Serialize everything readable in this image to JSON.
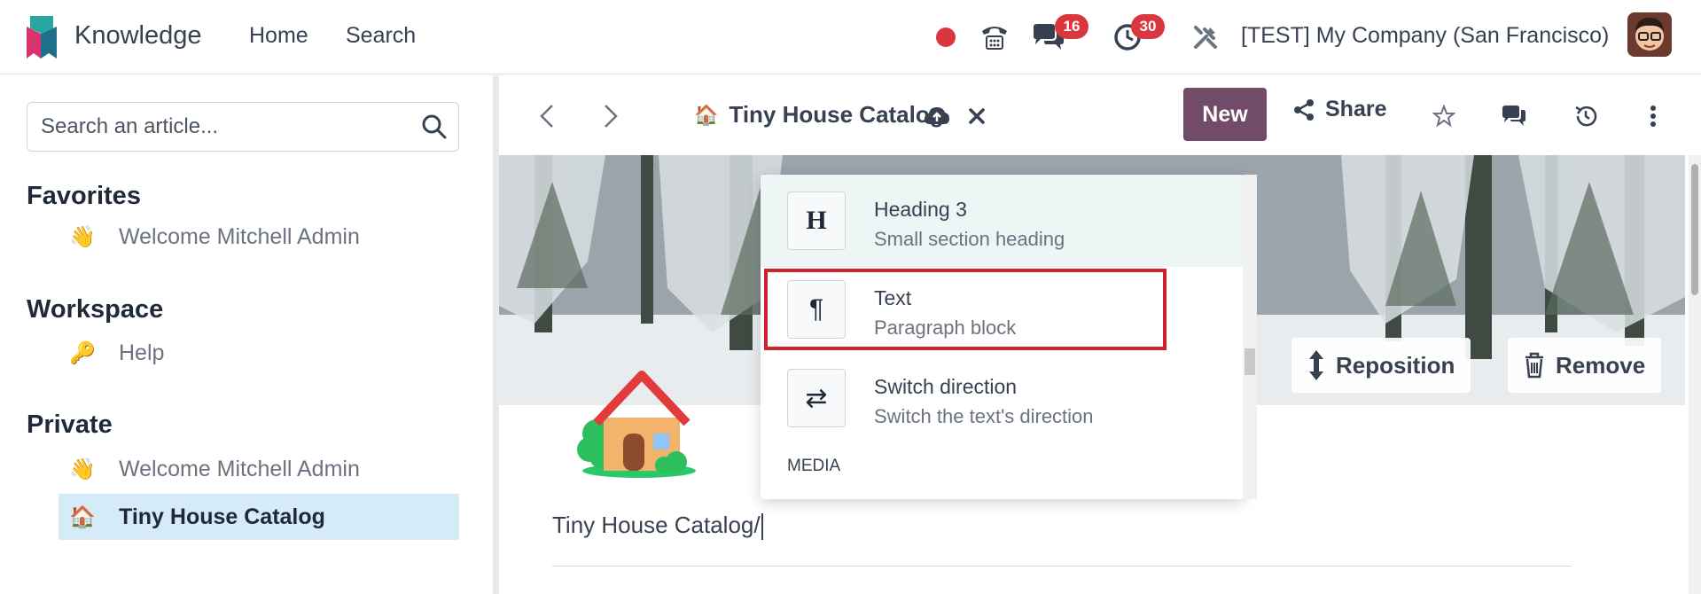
{
  "navbar": {
    "app_name": "Knowledge",
    "menu": [
      "Home",
      "Search"
    ],
    "messages_count": "16",
    "activities_count": "30",
    "company": "[TEST] My Company (San Francisco)"
  },
  "sidebar": {
    "search_placeholder": "Search an article...",
    "sections": {
      "favorites": {
        "title": "Favorites",
        "items": [
          {
            "emoji": "👋",
            "label": "Welcome Mitchell Admin"
          }
        ]
      },
      "workspace": {
        "title": "Workspace",
        "items": [
          {
            "emoji": "🔑",
            "label": "Help"
          }
        ]
      },
      "private": {
        "title": "Private",
        "items": [
          {
            "emoji": "👋",
            "label": "Welcome Mitchell Admin"
          },
          {
            "emoji": "🏠",
            "label": "Tiny House Catalog"
          }
        ]
      }
    }
  },
  "toolbar": {
    "article_emoji": "🏠",
    "article_title": "Tiny House Catalog",
    "new_label": "New",
    "share_label": "Share"
  },
  "cover": {
    "reposition_label": "Reposition",
    "remove_label": "Remove"
  },
  "editor": {
    "body_text": "Tiny House Catalog/"
  },
  "powerbox": {
    "items": [
      {
        "icon": "H",
        "title": "Heading 3",
        "description": "Small section heading"
      },
      {
        "icon": "¶",
        "title": "Text",
        "description": "Paragraph block"
      },
      {
        "icon": "⇄",
        "title": "Switch direction",
        "description": "Switch the text's direction"
      }
    ],
    "category": "MEDIA"
  },
  "colors": {
    "accent": "#714b67",
    "highlight": "#d0212e",
    "badge": "#d9363e",
    "active_sidebar": "#d5ebf8"
  }
}
